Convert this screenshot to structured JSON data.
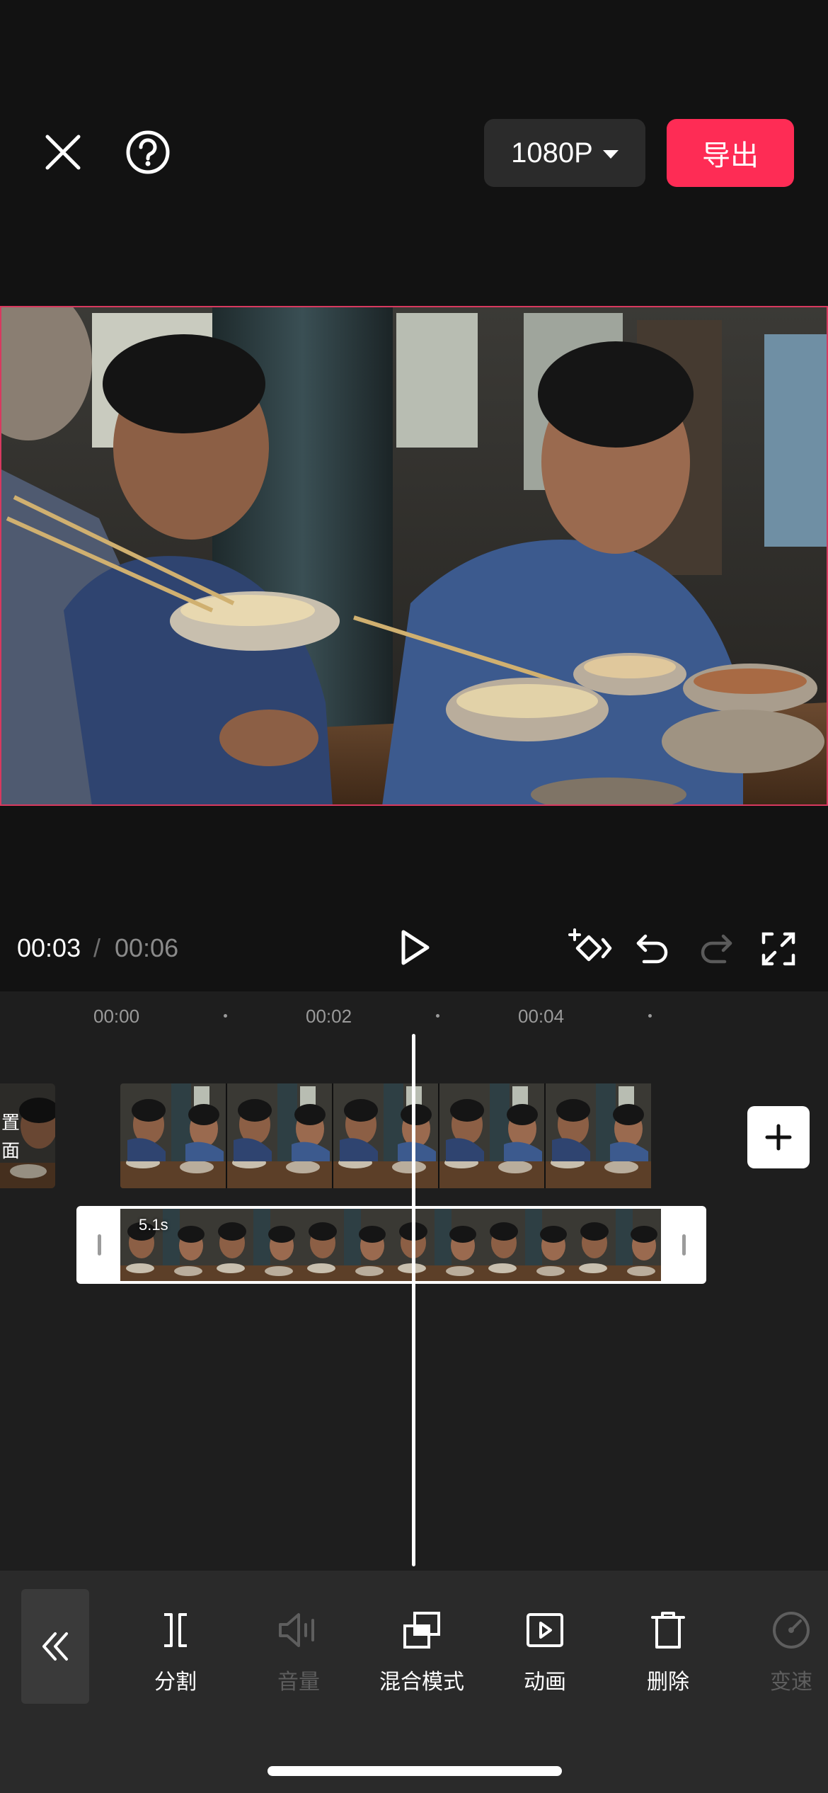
{
  "header": {
    "close_icon": "close-icon",
    "help_icon": "help-icon",
    "resolution_label": "1080P",
    "export_label": "导出",
    "export_color": "#fe2c55"
  },
  "preview": {
    "selection_border_color": "#d8395f"
  },
  "playback": {
    "current_time": "00:03",
    "separator": "/",
    "total_time": "00:06",
    "icons": [
      "play-icon",
      "keyframe-icon",
      "undo-icon",
      "redo-icon",
      "fullscreen-icon"
    ]
  },
  "timeline": {
    "ruler_labels": [
      "00:00",
      "00:02",
      "00:04"
    ],
    "left_clip_labels": [
      "置",
      "面"
    ],
    "selected_clip_duration": "5.1s",
    "add_icon": "plus-icon"
  },
  "toolbar": {
    "back_icon": "double-chevron-left-icon",
    "tools": [
      {
        "label": "分割",
        "icon": "split-icon",
        "enabled": true
      },
      {
        "label": "音量",
        "icon": "volume-icon",
        "enabled": false
      },
      {
        "label": "混合模式",
        "icon": "blend-mode-icon",
        "enabled": true
      },
      {
        "label": "动画",
        "icon": "animation-icon",
        "enabled": true
      },
      {
        "label": "删除",
        "icon": "delete-icon",
        "enabled": true
      },
      {
        "label": "变速",
        "icon": "speed-icon",
        "enabled": false
      }
    ]
  }
}
